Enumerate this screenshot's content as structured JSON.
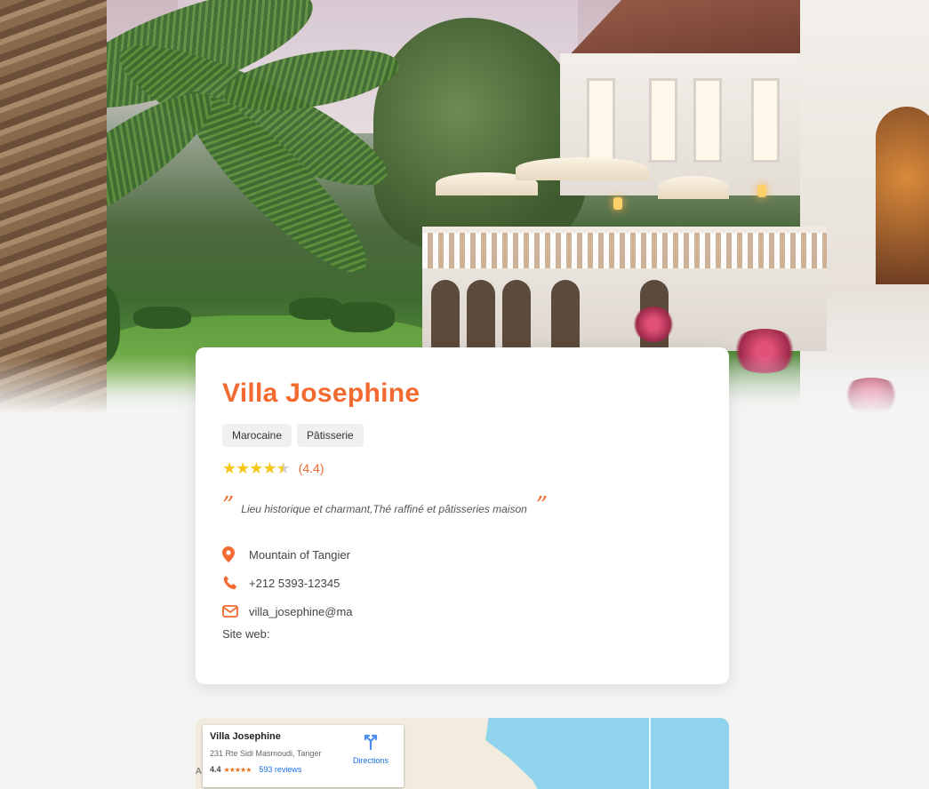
{
  "restaurant": {
    "name": "Villa Josephine",
    "tags": [
      "Marocaine",
      "Pâtisserie"
    ],
    "rating_value": 4.4,
    "rating_label": "(4.4)",
    "quote": "Lieu historique et charmant,Thé raffiné et pâtisseries maison",
    "quote_open": "”",
    "quote_close": "”",
    "address": "Mountain of Tangier",
    "phone": "+212 5393-12345",
    "email": "villa_josephine@ma",
    "website_label": "Site web:",
    "icons": {
      "address": "map-pin-icon",
      "phone": "phone-icon",
      "email": "envelope-icon"
    },
    "accent_color": "#f26a30"
  },
  "map": {
    "place_name": "Villa Josephine",
    "place_address": "231 Rte Sidi Masmoudi, Tanger",
    "place_rating": "4.4",
    "place_reviews": "593 reviews",
    "directions_label": "Directions",
    "edge_label": "A"
  }
}
